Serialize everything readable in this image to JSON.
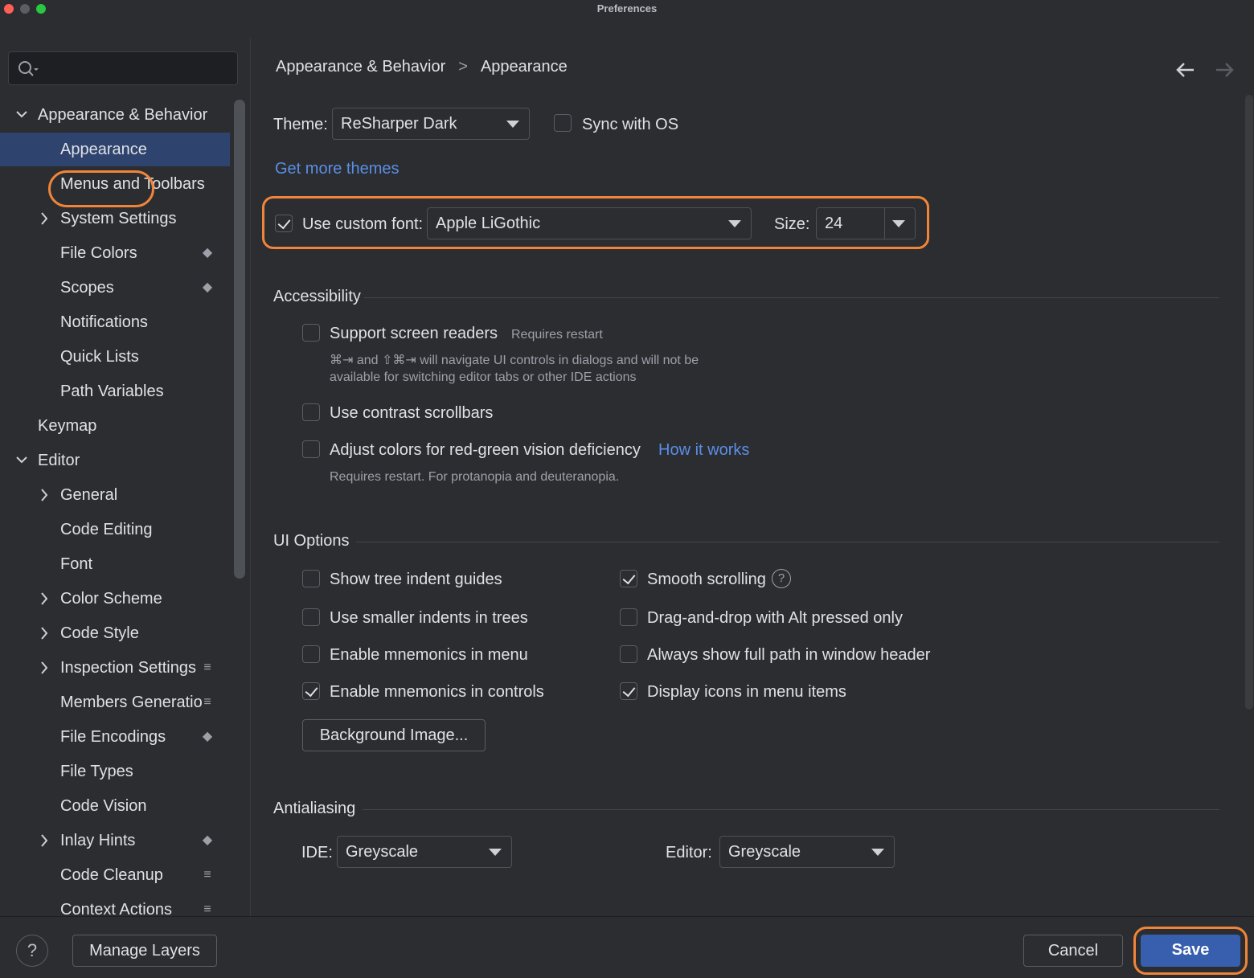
{
  "window": {
    "title": "Preferences"
  },
  "sidebar": {
    "search_placeholder": "",
    "items": [
      {
        "label": "Appearance & Behavior",
        "expanded": true,
        "level": 0
      },
      {
        "label": "Appearance",
        "level": 1,
        "selected": true
      },
      {
        "label": "Menus and Toolbars",
        "level": 1
      },
      {
        "label": "System Settings",
        "level": 1,
        "has_arrow": true
      },
      {
        "label": "File Colors",
        "level": 1,
        "icon": "layer-icon"
      },
      {
        "label": "Scopes",
        "level": 1,
        "icon": "layer-icon"
      },
      {
        "label": "Notifications",
        "level": 1
      },
      {
        "label": "Quick Lists",
        "level": 1
      },
      {
        "label": "Path Variables",
        "level": 1
      },
      {
        "label": "Keymap",
        "level": 0
      },
      {
        "label": "Editor",
        "expanded": true,
        "level": 0
      },
      {
        "label": "General",
        "level": 1,
        "has_arrow": true
      },
      {
        "label": "Code Editing",
        "level": 1
      },
      {
        "label": "Font",
        "level": 1
      },
      {
        "label": "Color Scheme",
        "level": 1,
        "has_arrow": true
      },
      {
        "label": "Code Style",
        "level": 1,
        "has_arrow": true
      },
      {
        "label": "Inspection Settings",
        "level": 1,
        "has_arrow": true,
        "icon": "stack-icon"
      },
      {
        "label": "Members Generatio",
        "level": 1,
        "icon": "stack-icon"
      },
      {
        "label": "File Encodings",
        "level": 1,
        "icon": "layer-icon"
      },
      {
        "label": "File Types",
        "level": 1
      },
      {
        "label": "Code Vision",
        "level": 1
      },
      {
        "label": "Inlay Hints",
        "level": 1,
        "has_arrow": true,
        "icon": "layer-icon"
      },
      {
        "label": "Code Cleanup",
        "level": 1,
        "icon": "stack-icon"
      },
      {
        "label": "Context Actions",
        "level": 1,
        "icon": "stack-icon"
      }
    ]
  },
  "breadcrumb": {
    "parent": "Appearance & Behavior",
    "separator": ">",
    "current": "Appearance"
  },
  "theme": {
    "label": "Theme:",
    "value": "ReSharper Dark",
    "sync_label": "Sync with OS",
    "sync_checked": false,
    "more_link": "Get more themes"
  },
  "font": {
    "use_custom_label": "Use custom font:",
    "checked": true,
    "value": "Apple LiGothic",
    "size_label": "Size:",
    "size_value": "24"
  },
  "accessibility": {
    "title": "Accessibility",
    "screen_readers": {
      "label": "Support screen readers",
      "note": "Requires restart",
      "checked": false,
      "hint_line1": "⌘⇥ and ⇧⌘⇥ will navigate UI controls in dialogs and will not be",
      "hint_line2": "available for switching editor tabs or other IDE actions"
    },
    "contrast_scrollbars": {
      "label": "Use contrast scrollbars",
      "checked": false
    },
    "color_deficiency": {
      "label": "Adjust colors for red-green vision deficiency",
      "link": "How it works",
      "checked": false,
      "note": "Requires restart. For protanopia and deuteranopia."
    }
  },
  "ui_options": {
    "title": "UI Options",
    "left": [
      {
        "label": "Show tree indent guides",
        "checked": false
      },
      {
        "label": "Use smaller indents in trees",
        "checked": false
      },
      {
        "label": "Enable mnemonics in menu",
        "checked": false
      },
      {
        "label": "Enable mnemonics in controls",
        "checked": true
      }
    ],
    "right": [
      {
        "label": "Smooth scrolling",
        "checked": true,
        "help": "?"
      },
      {
        "label": "Drag-and-drop with Alt pressed only",
        "checked": false
      },
      {
        "label": "Always show full path in window header",
        "checked": false
      },
      {
        "label": "Display icons in menu items",
        "checked": true
      }
    ],
    "background_button": "Background Image..."
  },
  "antialiasing": {
    "title": "Antialiasing",
    "ide_label": "IDE:",
    "ide_value": "Greyscale",
    "editor_label": "Editor:",
    "editor_value": "Greyscale"
  },
  "footer": {
    "help": "?",
    "manage_layers": "Manage Layers",
    "cancel": "Cancel",
    "save": "Save"
  },
  "colors": {
    "accent": "#375fad",
    "highlight": "#f0853a",
    "link": "#5b8ee6",
    "selection": "#2e436e"
  }
}
